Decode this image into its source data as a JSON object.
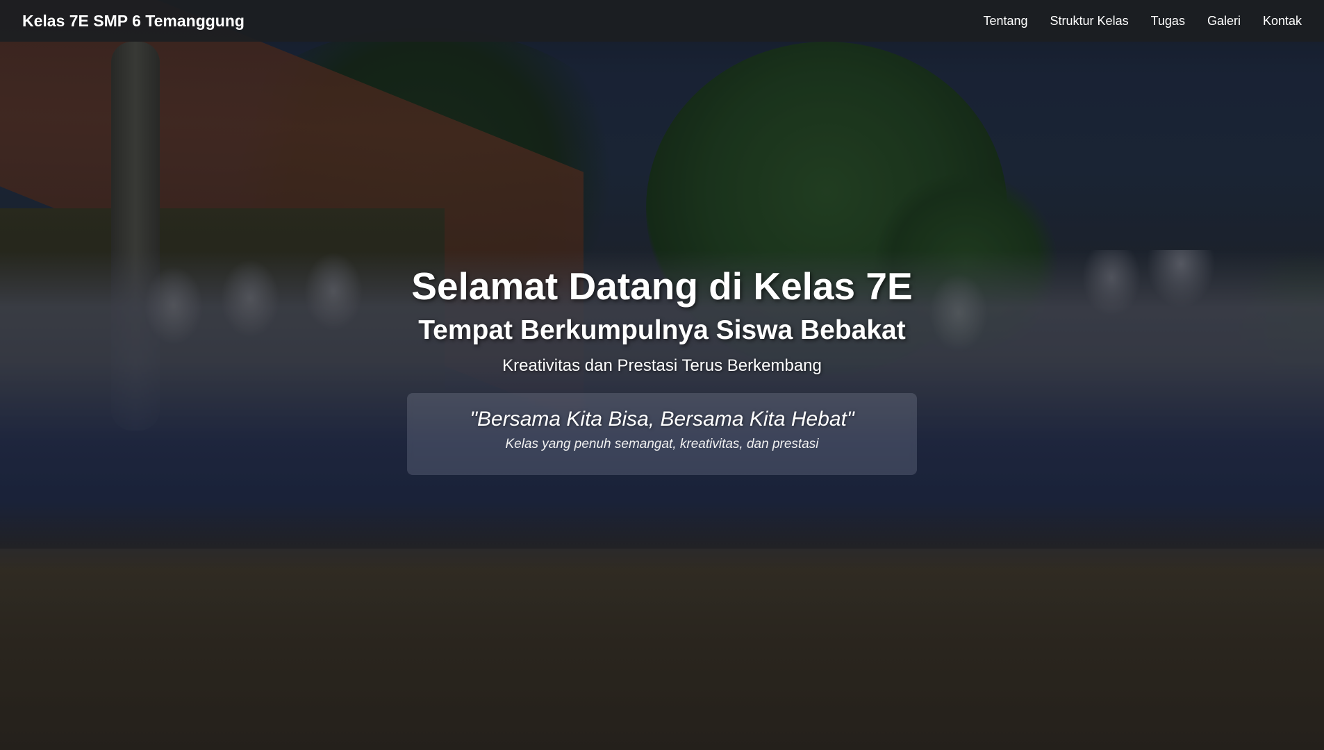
{
  "navbar": {
    "brand": "Kelas 7E SMP 6 Temanggung",
    "links": [
      "Tentang",
      "Struktur Kelas",
      "Tugas",
      "Galeri",
      "Kontak"
    ]
  },
  "hero": {
    "title": "Selamat Datang di Kelas 7E",
    "subtitle": "Tempat Berkumpulnya Siswa Bebakat",
    "tagline": "Kreativitas dan Prestasi Terus Berkembang",
    "quote": "\"Bersama Kita Bisa, Bersama Kita Hebat\"",
    "quote_caption": "Kelas yang penuh semangat, kreativitas, dan prestasi"
  },
  "colors": {
    "navbar_bg": "#1c1e22",
    "text": "#ffffff"
  }
}
